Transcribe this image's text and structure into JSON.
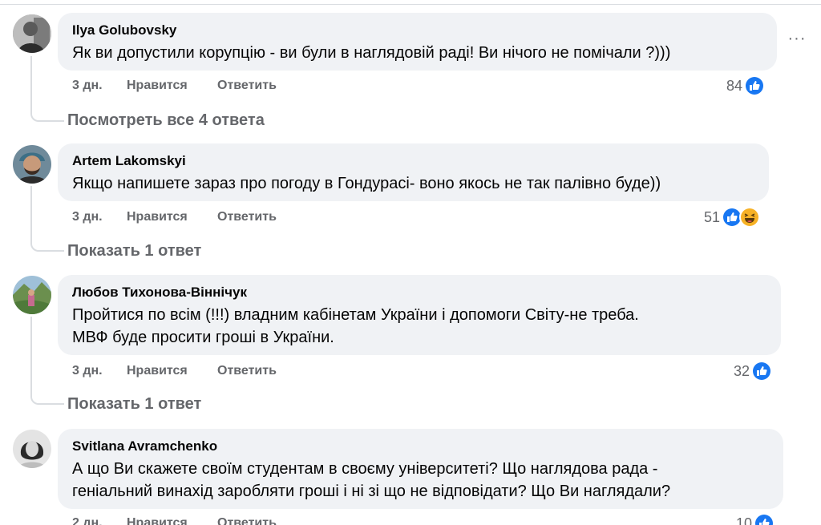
{
  "ui": {
    "more_icon": "more-horizontal-icon",
    "like_reaction_icon": "like-reaction-icon",
    "haha_reaction_icon": "haha-reaction-icon",
    "like_color": "#1877f2",
    "haha_color": "#f7b125",
    "bubble_color": "#f0f2f5",
    "meta_color": "#65676b"
  },
  "comments": [
    {
      "author": "Ilya Golubovsky",
      "text": "Як ви допустили корупцію - ви були в наглядовій раді! Ви нічого не помічали ?)))",
      "time": "3 дн.",
      "like_label": "Нравится",
      "reply_label": "Ответить",
      "reaction_count": "84",
      "replies_label": "Посмотреть все 4 ответа"
    },
    {
      "author": "Artem Lakomskyi",
      "text": "Якщо напишете зараз про погоду в Гондурасі- воно якось не так палівно буде))",
      "time": "3 дн.",
      "like_label": "Нравится",
      "reply_label": "Ответить",
      "reaction_count": "51",
      "replies_label": "Показать 1 ответ"
    },
    {
      "author": "Любов Тихонова-Віннічук",
      "text": "Пройтися по всім (!!!) владним кабінетам України і допомоги Світу-не треба.\nМВФ буде просити гроші в України.",
      "time": "3 дн.",
      "like_label": "Нравится",
      "reply_label": "Ответить",
      "reaction_count": "32",
      "replies_label": "Показать 1 ответ"
    },
    {
      "author": "Svitlana Avramchenko",
      "text": "А що Ви скажете своїм студентам в своєму університеті? Що наглядова рада -\nгеніальний винахід заробляти гроші і ні зі що не відповідати? Що Ви наглядали?",
      "time": "2 дн.",
      "like_label": "Нравится",
      "reply_label": "Ответить",
      "reaction_count": "10"
    }
  ]
}
